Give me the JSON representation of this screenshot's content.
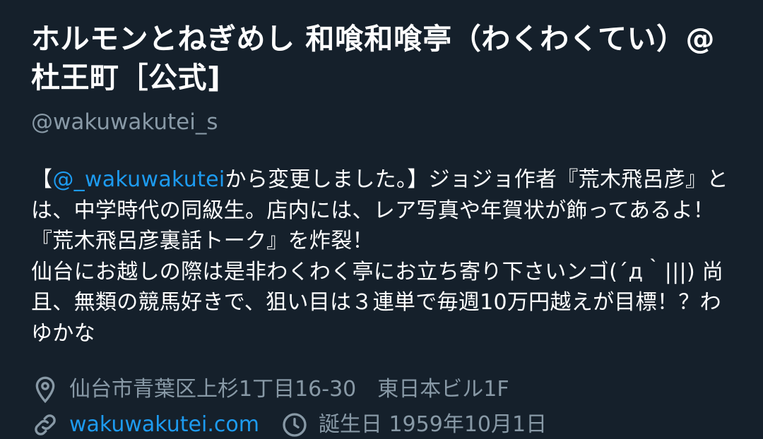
{
  "profile": {
    "display_name": "ホルモンとねぎめし 和喰和喰亭（わくわくてい）@杜王町［公式]",
    "handle": "@wakuwakutei_s",
    "bio": {
      "prefix": "【",
      "mention": "@_wakuwakutei",
      "text": "から変更しました。】ジョジョ作者『荒木飛呂彦』とは、中学時代の同級生。店内には、レア写真や年賀状が飾ってあるよ！『荒木飛呂彦裏話トーク』を炸裂！\n仙台にお越しの際は是非わくわく亭にお立ち寄り下さいンゴ(´д｀|||) 尚且、無類の競馬好きで、狙い目は３連単で毎週10万円越えが目標！？わゆかな"
    },
    "location": "仙台市青葉区上杉1丁目16-30　東日本ビル1F",
    "website": "wakuwakutei.com",
    "joined": "誕生日 1959年10月1日"
  },
  "icons": {
    "location": "location-pin-icon",
    "link": "link-icon",
    "birthday": "clock-icon"
  },
  "colors": {
    "background": "#15202b",
    "secondary_text": "#8899a6",
    "accent": "#1d9bf0"
  }
}
